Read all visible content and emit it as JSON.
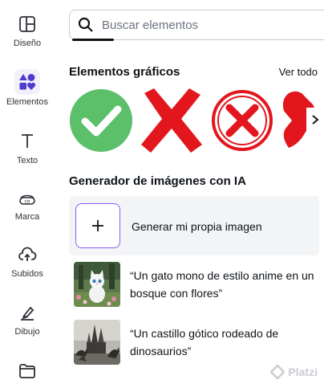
{
  "sidebar": {
    "items": [
      {
        "label": "Diseño",
        "icon": "layout-icon"
      },
      {
        "label": "Elementos",
        "icon": "shapes-icon"
      },
      {
        "label": "Texto",
        "icon": "text-icon"
      },
      {
        "label": "Marca",
        "icon": "brand-icon"
      },
      {
        "label": "Subidos",
        "icon": "cloud-upload-icon"
      },
      {
        "label": "Dibujo",
        "icon": "pen-icon"
      },
      {
        "label": "",
        "icon": "folder-icon"
      }
    ]
  },
  "search": {
    "placeholder": "Buscar elementos"
  },
  "graphics": {
    "title": "Elementos gráficos",
    "see_all": "Ver todo",
    "items": [
      "check-mark-icon",
      "red-x-icon",
      "red-circle-x-icon",
      "red-x-partial-icon"
    ]
  },
  "ai_generator": {
    "title": "Generador de imágenes con IA",
    "generate_label": "Generar mi propia imagen",
    "prompts": [
      {
        "text": "“Un gato mono de estilo anime en un bosque con flores”"
      },
      {
        "text": "“Un castillo gótico rodeado de dinosaurios”"
      }
    ]
  },
  "watermark": {
    "text": "Platzi"
  },
  "colors": {
    "accent": "#8b5cf6",
    "active_icon": "#4f3ccf",
    "check_green": "#5cbf6a",
    "cross_red": "#e3161d"
  }
}
